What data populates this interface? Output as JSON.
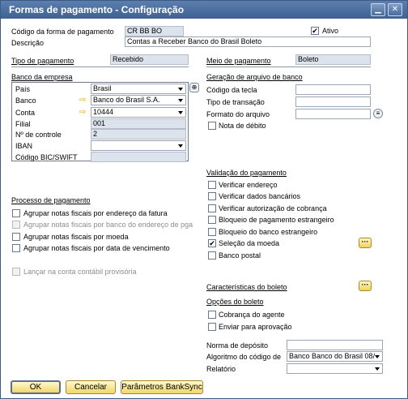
{
  "window": {
    "title": "Formas de pagamento - Configuração",
    "minimize_icon": "minimize-icon",
    "close_icon": "close-icon"
  },
  "header": {
    "code_label": "Código da forma de pagamento",
    "code_value": "CR BB BO",
    "ativo_label": "Ativo",
    "ativo_checked": "✔",
    "desc_label": "Descrição",
    "desc_value": "Contas a Receber Banco do Brasil Boleto",
    "tipo_label": "Tipo de pagamento",
    "tipo_value": "Recebido",
    "meio_label": "Meio de pagamento",
    "meio_value": "Boleto"
  },
  "bank": {
    "title": "Banco da empresa",
    "pais_label": "País",
    "pais_value": "Brasil",
    "banco_label": "Banco",
    "banco_value": "Banco do Brasil S.A.",
    "conta_label": "Conta",
    "conta_value": "10444",
    "filial_label": "Filial",
    "filial_value": "001",
    "controle_label": "Nº de controle",
    "controle_value": "2",
    "iban_label": "IBAN",
    "iban_value": "",
    "bic_label": "Código BIC/SWIFT",
    "bic_value": ""
  },
  "file_gen": {
    "title": "Geração de arquivo de banco",
    "tecla_label": "Código da tecla",
    "transacao_label": "Tipo de transação",
    "formato_label": "Formato do arquivo",
    "nota_debito_label": "Nota de débito"
  },
  "validation": {
    "title": "Validação do pagamento",
    "items": [
      {
        "label": "Verificar endereço",
        "checked": ""
      },
      {
        "label": "Verificar dados bancários",
        "checked": ""
      },
      {
        "label": "Verificar autorização de cobrança",
        "checked": ""
      },
      {
        "label": "Bloqueio de pagamento estrangeiro",
        "checked": ""
      },
      {
        "label": "Bloqueio do banco estrangeiro",
        "checked": ""
      },
      {
        "label": "Seleção da moeda",
        "checked": "✔"
      },
      {
        "label": "Banco postal",
        "checked": ""
      }
    ]
  },
  "process": {
    "title": "Processo de pagamento",
    "items": [
      {
        "label": "Agrupar notas fiscais por endereço da fatura",
        "checked": ""
      },
      {
        "label": "Agrupar notas fiscais por banco do endereço de pga",
        "checked": ""
      },
      {
        "label": "Agrupar notas fiscais por moeda",
        "checked": ""
      },
      {
        "label": "Agrupar notas fiscais por data de vencimento",
        "checked": ""
      }
    ],
    "lancar_label": "Lançar na conta contábil provisória"
  },
  "boleto": {
    "caracteristicas_label": "Características do boleto",
    "opcoes_title": "Opções do boleto",
    "cobranca_label": "Cobrança do agente",
    "enviar_label": "Enviar para aprovação",
    "norma_label": "Norma de depósito",
    "norma_value": "",
    "algoritmo_label": "Algoritmo do código de",
    "algoritmo_value": "Banco Banco do Brasil 08/",
    "relatorio_label": "Relatório",
    "relatorio_value": ""
  },
  "buttons": {
    "ok": "OK",
    "cancelar": "Cancelar",
    "banksync": "Parâmetros BankSync",
    "dots": "···"
  },
  "colors": {
    "titlebar": "#4a6c9c",
    "readonly_field": "#dde3ec",
    "button": "#f2d667",
    "link_arrow": "#e6a400"
  }
}
